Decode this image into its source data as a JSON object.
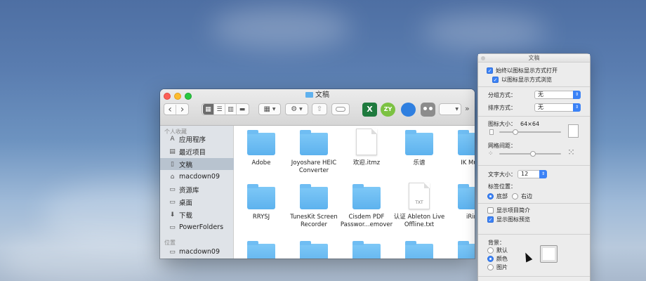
{
  "finder": {
    "title": "文稿",
    "toolbar": {
      "back": "‹",
      "forward": "›",
      "more": "»"
    },
    "sidebar": {
      "favorites_heading": "个人收藏",
      "favorites": [
        {
          "label": "应用程序",
          "icon": "applications-icon",
          "glyph": "A"
        },
        {
          "label": "最近项目",
          "icon": "recents-icon",
          "glyph": "▤"
        },
        {
          "label": "文稿",
          "icon": "documents-icon",
          "glyph": "▯"
        },
        {
          "label": "macdown09",
          "icon": "home-icon",
          "glyph": "⌂"
        },
        {
          "label": "资源库",
          "icon": "folder-icon",
          "glyph": "▭"
        },
        {
          "label": "桌面",
          "icon": "desktop-icon",
          "glyph": "▭"
        },
        {
          "label": "下载",
          "icon": "downloads-icon",
          "glyph": "⬇"
        },
        {
          "label": "PowerFolders",
          "icon": "folder-icon",
          "glyph": "▭"
        }
      ],
      "locations_heading": "位置",
      "locations": [
        {
          "label": "macdown09",
          "icon": "computer-icon",
          "glyph": "▭"
        }
      ]
    },
    "files": [
      {
        "name": "Adobe",
        "kind": "folder"
      },
      {
        "name": "Joyoshare HEIC Converter",
        "kind": "folder"
      },
      {
        "name": "欢迎.itmz",
        "kind": "doc"
      },
      {
        "name": "乐谱",
        "kind": "folder"
      },
      {
        "name": "IK Multi",
        "kind": "folder"
      },
      {
        "name": "RRYSJ",
        "kind": "folder"
      },
      {
        "name": "TunesKit Screen Recorder",
        "kind": "folder"
      },
      {
        "name": "Cisdem PDF Passwor...emover",
        "kind": "folder"
      },
      {
        "name": "认证 Ableton Live Offline.txt",
        "kind": "txt",
        "tag": "TXT"
      },
      {
        "name": "iRin",
        "kind": "folder"
      }
    ]
  },
  "panel": {
    "title": "文稿",
    "always_icon_view": "始终以图标显示方式打开",
    "browse_icon_view": "以图标显示方式浏览",
    "group_by_label": "分组方式：",
    "group_by_value": "无",
    "sort_by_label": "排序方式：",
    "sort_by_value": "无",
    "icon_size_label": "图标大小：",
    "icon_size_value": "64×64",
    "grid_spacing_label": "网格间距：",
    "text_size_label": "文字大小：",
    "text_size_value": "12",
    "label_position_label": "标签位置：",
    "label_bottom": "底部",
    "label_right": "右边",
    "show_item_info": "显示项目简介",
    "show_icon_preview": "显示图标预览",
    "background_label": "背景：",
    "bg_default": "默认",
    "bg_color": "颜色",
    "bg_picture": "图片",
    "colors": {
      "accent": "#3b82f6",
      "folder": "#5db2ee"
    }
  }
}
